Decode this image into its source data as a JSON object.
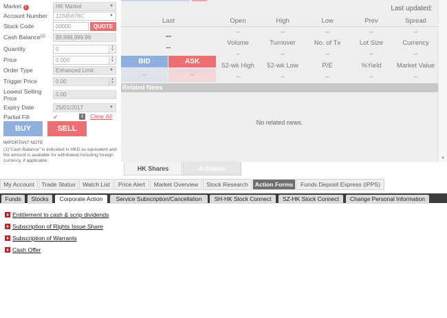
{
  "order_form": {
    "market": {
      "label": "Market",
      "value": "HK Market"
    },
    "account": {
      "label": "Account Number",
      "value": "12345678C"
    },
    "stock_code": {
      "label": "Stock Code",
      "value": "00000",
      "quote_label": "QUOTE"
    },
    "cash_balance": {
      "label": "Cash Balance",
      "sup": "(1)",
      "value": "$9,999,999.99"
    },
    "quantity": {
      "label": "Quantity",
      "value": "0"
    },
    "price": {
      "label": "Price",
      "value": "0.000"
    },
    "order_type": {
      "label": "Order Type",
      "value": "Enhanced Limit"
    },
    "trigger_price": {
      "label": "Trigger Price",
      "value": "0.00"
    },
    "lowest_selling": {
      "label": "Lowest Selling Price",
      "value": "0.00"
    },
    "expiry_date": {
      "label": "Expiry Date",
      "value": "25/01/2017"
    },
    "partial_fill": {
      "label": "Partial Fill",
      "check": "✔",
      "info": "i",
      "clear_label": "Clear All"
    },
    "buy_label": "BUY",
    "sell_label": "SELL",
    "note_title": "IMPORTANT NOTE",
    "note_text": "(1)\"Cash Balance\" is indicated in HKD as equivalent and the amount is available for withdrawal including foreign currency, if applicable."
  },
  "quote": {
    "last_updated_label": "Last updated:",
    "last_label": "Last",
    "last_value": "--",
    "change_value": "--",
    "row1_headers": [
      "Open",
      "High",
      "Low",
      "Prev",
      "Spread"
    ],
    "row1_values": [
      "--",
      "--",
      "--",
      "--",
      "--"
    ],
    "row2_headers": [
      "Volume",
      "Turnover",
      "No. of Tx",
      "Lot Size",
      "Currency"
    ],
    "row2_values": [
      "--",
      "--",
      "--",
      "--",
      "--"
    ],
    "row3_headers": [
      "52-wk High",
      "52-wk Low",
      "P/E",
      "%Yield",
      "Market Value"
    ],
    "row3_values": [
      "--",
      "--",
      "--",
      "--",
      "--"
    ],
    "bid_label": "BID",
    "ask_label": "ASK",
    "bid_value": "--",
    "ask_value": "--",
    "related_news_label": "Related News",
    "no_news": "No related news."
  },
  "sub_tabs": {
    "active": "HK Shares",
    "inactive": "A-Shares"
  },
  "main_nav": [
    "My Account",
    "Trade Status",
    "Watch List",
    "Price Alert",
    "Market Overview",
    "Stock Research",
    "Action Forms",
    "Funds Deposit Express (iPPS)"
  ],
  "main_nav_active": "Action Forms",
  "secondary_nav": [
    "Funds",
    "Stocks",
    "Corporate Action",
    "Service Subscription/Cancellation",
    "SH-HK Stock Connect",
    "SZ-HK Stock Connect",
    "Change Personal Information"
  ],
  "secondary_nav_active": "Corporate Action",
  "links": [
    "Entitlement to cash & scrip dividends",
    "Subscription of Rights Issue Share",
    "Subscription of Warrants",
    "Cash Offer"
  ],
  "colors": {
    "bid": "#8fb0de",
    "ask": "#ee6f72",
    "nav_dark": "#3c3c3c",
    "link_bullet": "#cc1f24"
  }
}
